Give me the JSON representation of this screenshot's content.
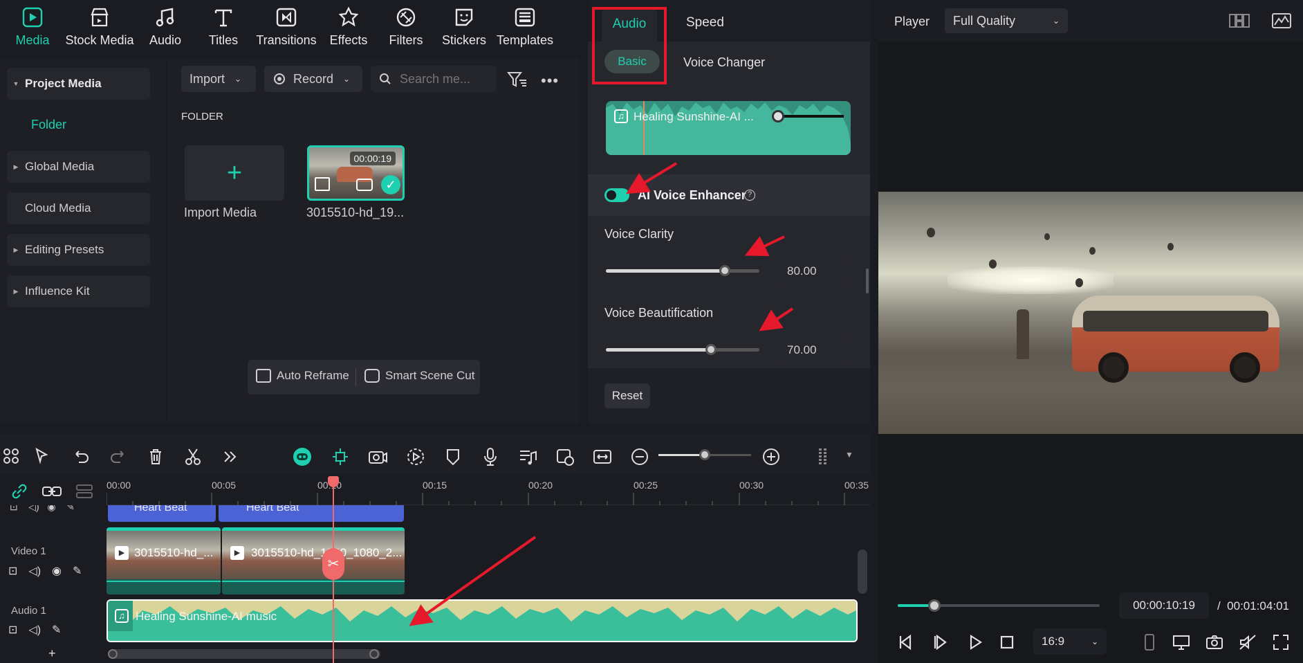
{
  "toolbar": {
    "items": [
      {
        "label": "Media",
        "icon": "media-icon"
      },
      {
        "label": "Stock Media",
        "icon": "stock-media-icon"
      },
      {
        "label": "Audio",
        "icon": "music-note-icon"
      },
      {
        "label": "Titles",
        "icon": "titles-icon"
      },
      {
        "label": "Transitions",
        "icon": "transitions-icon"
      },
      {
        "label": "Effects",
        "icon": "effects-icon"
      },
      {
        "label": "Filters",
        "icon": "filters-icon"
      },
      {
        "label": "Stickers",
        "icon": "stickers-icon"
      },
      {
        "label": "Templates",
        "icon": "templates-icon"
      }
    ]
  },
  "sidebar": {
    "items": [
      {
        "label": "Project Media"
      },
      {
        "label": "Folder"
      },
      {
        "label": "Global Media"
      },
      {
        "label": "Cloud Media"
      },
      {
        "label": "Editing Presets"
      },
      {
        "label": "Influence Kit"
      }
    ]
  },
  "media": {
    "import_label": "Import",
    "record_label": "Record",
    "search_placeholder": "Search me...",
    "folder_label": "FOLDER",
    "import_media_label": "Import Media",
    "clip_name": "3015510-hd_19...",
    "clip_duration": "00:00:19",
    "auto_reframe": "Auto Reframe",
    "smart_scene_cut": "Smart Scene Cut"
  },
  "audio_panel": {
    "tabs": [
      "Audio",
      "Speed"
    ],
    "subtabs": [
      "Basic",
      "Voice Changer"
    ],
    "track_name": "Healing Sunshine-AI ...",
    "enhancer_label": "AI Voice Enhancer",
    "enhancer_on": true,
    "clarity_label": "Voice Clarity",
    "clarity_value": "80.00",
    "clarity_level": 0.8,
    "beautification_label": "Voice Beautification",
    "beautification_value": "70.00",
    "beautification_level": 0.7,
    "reset_label": "Reset"
  },
  "player": {
    "label": "Player",
    "quality": "Full Quality",
    "current_time": "00:00:10:19",
    "total_time": "/  00:01:04:01",
    "progress": 0.18,
    "aspect": "16:9"
  },
  "timeline": {
    "ruler": [
      "00:00",
      "00:05",
      "00:10",
      "00:15",
      "00:20",
      "00:25",
      "00:30",
      "00:35"
    ],
    "title_clips": [
      "Heart Beat",
      "Heart Beat"
    ],
    "video_track_label": "Video 1",
    "audio_track_label": "Audio 1",
    "video_clips": [
      "3015510-hd_...",
      "3015510-hd_1920_1080_2..."
    ],
    "audio_clip": "Healing Sunshine-AI music",
    "add_track": "+"
  },
  "colors": {
    "accent": "#1fd0b0",
    "annotation": "#e5192b",
    "playhead": "#f06a6a",
    "audio_clip": "#3bbf9b",
    "title_clip": "#4c63d6"
  }
}
